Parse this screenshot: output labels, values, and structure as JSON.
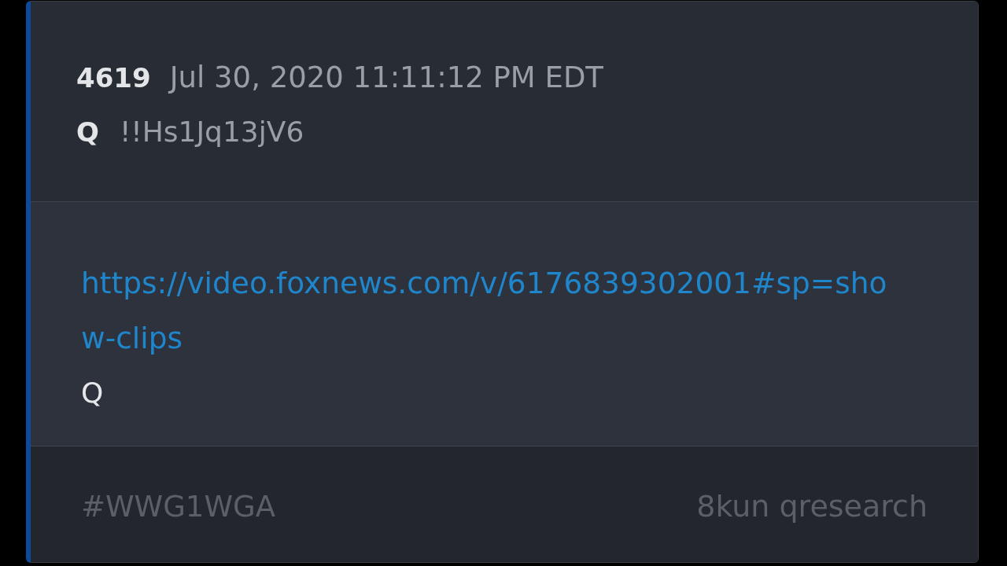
{
  "post": {
    "number": "4619",
    "timestamp": "Jul 30, 2020 11:11:12 PM EDT",
    "author": "Q",
    "tripcode": "!!Hs1Jq13jV6",
    "body": [
      {
        "kind": "link",
        "text": "https://video.foxnews.com/v/6176839302001#sp=show-clips"
      },
      {
        "kind": "text",
        "text": "Q"
      }
    ],
    "footer": {
      "hashtag": "#WWG1WGA",
      "source": "8kun qresearch"
    }
  }
}
